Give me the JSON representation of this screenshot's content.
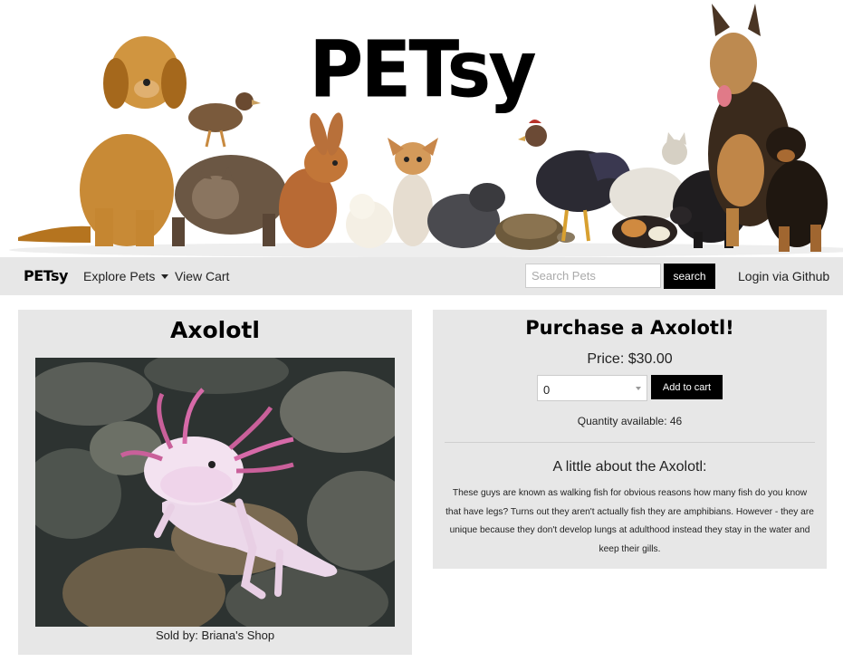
{
  "banner": {
    "title": "PETsy",
    "image_description": "row of pets: dog, quail, cat, rabbit, chick, chihuahua, silkie, tortoise, rooster, guinea pig, cat, pig, german shepherd and puppy"
  },
  "navbar": {
    "logo": "PETsy",
    "explore_label": "Explore Pets",
    "cart_label": "View Cart",
    "search_placeholder": "Search Pets",
    "search_button": "search",
    "login_label": "Login via Github"
  },
  "pet": {
    "name": "Axolotl",
    "photo": "axolotl-photo",
    "seller": "Sold by: Briana's Shop"
  },
  "purchase": {
    "title": "Purchase a Axolotl!",
    "price": "Price: $30.00",
    "quantity_selected": "0",
    "add_button": "Add to cart",
    "available": "Quantity available: 46"
  },
  "about": {
    "title": "A little about the Axolotl:",
    "text": "These guys are known as walking fish for obvious reasons how many fish do you know that have legs? Turns out they aren't actually fish they are amphibians. However - they are unique because they don't develop lungs at adulthood instead they stay in the water and keep their gills."
  },
  "colors": {
    "navbar_bg": "#e7e7e7",
    "card_bg": "#e7e7e7",
    "button_bg": "#000000",
    "button_text": "#ffffff"
  }
}
